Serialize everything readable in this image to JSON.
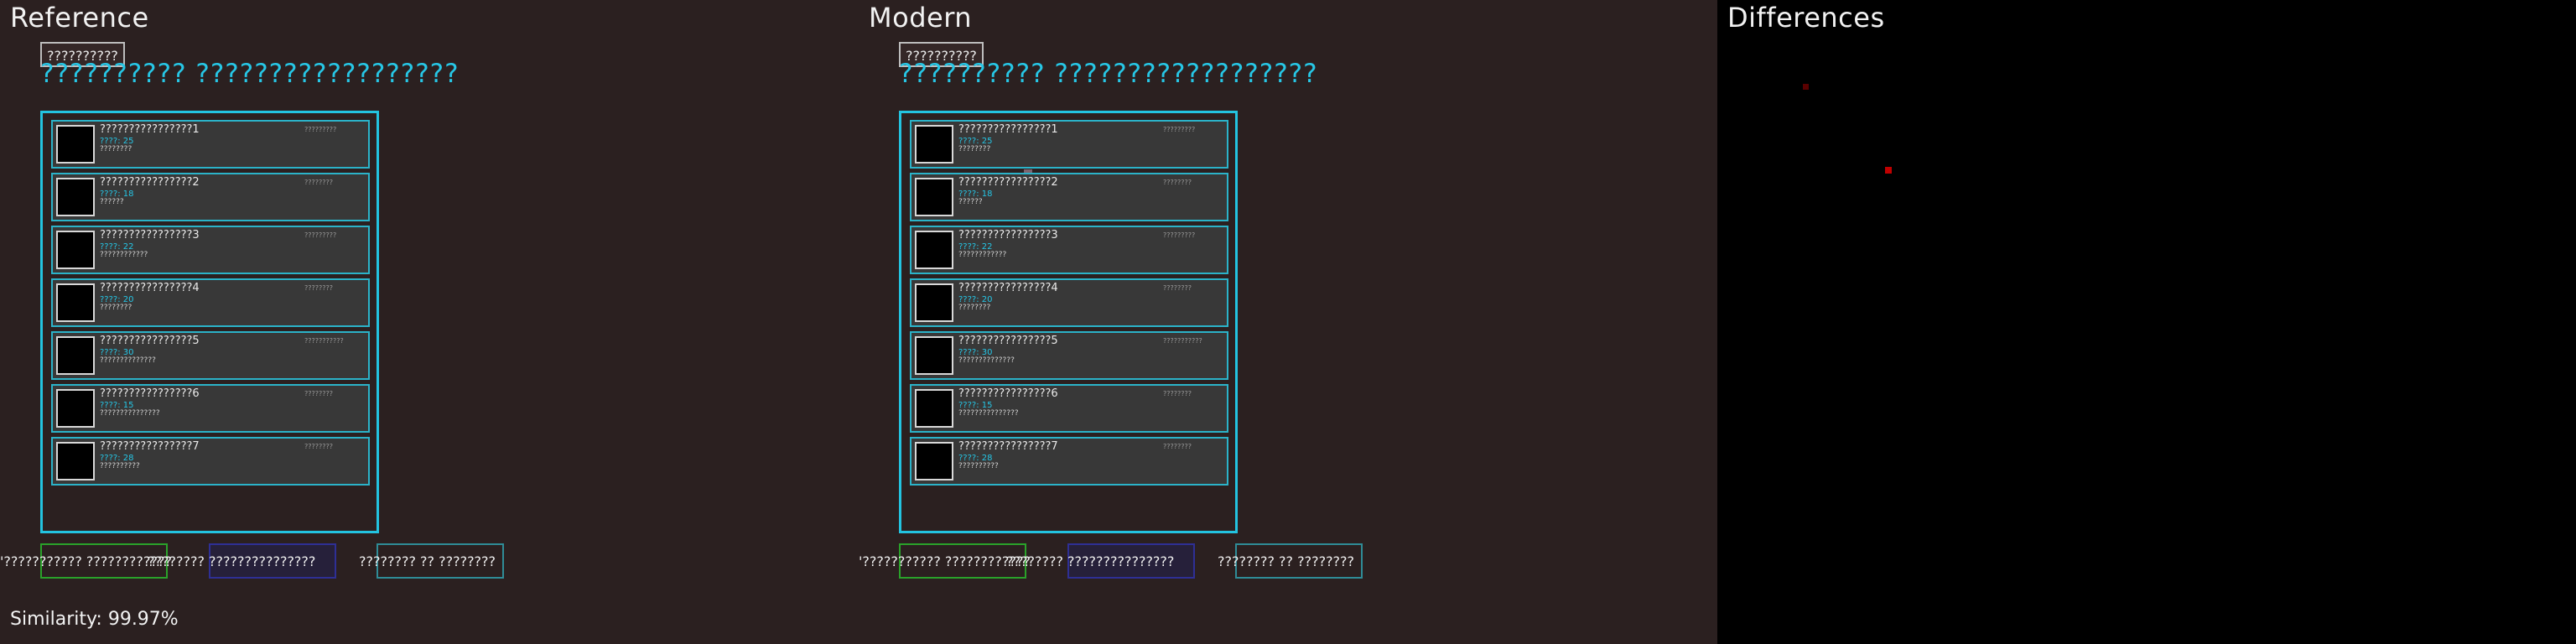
{
  "panels": {
    "reference_label": "Reference",
    "modern_label": "Modern",
    "differences_label": "Differences"
  },
  "top_button": "??????????",
  "heading": "?????????? ??????????????????",
  "cards": [
    {
      "title": "????????????????1",
      "sub": "????: 25",
      "desc": "????????",
      "meta": "?????????"
    },
    {
      "title": "????????????????2",
      "sub": "????: 18",
      "desc": "??????",
      "meta": "????????"
    },
    {
      "title": "????????????????3",
      "sub": "????: 22",
      "desc": "????????????",
      "meta": "?????????"
    },
    {
      "title": "????????????????4",
      "sub": "????: 20",
      "desc": "????????",
      "meta": "????????"
    },
    {
      "title": "????????????????5",
      "sub": "????: 30",
      "desc": "??????????????",
      "meta": "???????????"
    },
    {
      "title": "????????????????6",
      "sub": "????: 15",
      "desc": "???????????????",
      "meta": "????????"
    },
    {
      "title": "????????????????7",
      "sub": "????: 28",
      "desc": "??????????",
      "meta": "????????"
    }
  ],
  "bottom": {
    "label_left": "'??????????? ????????????",
    "label_middle": "???????? ???????????????",
    "label_right": "???????? ?? ????????"
  },
  "similarity": "Similarity:  99.97%"
}
